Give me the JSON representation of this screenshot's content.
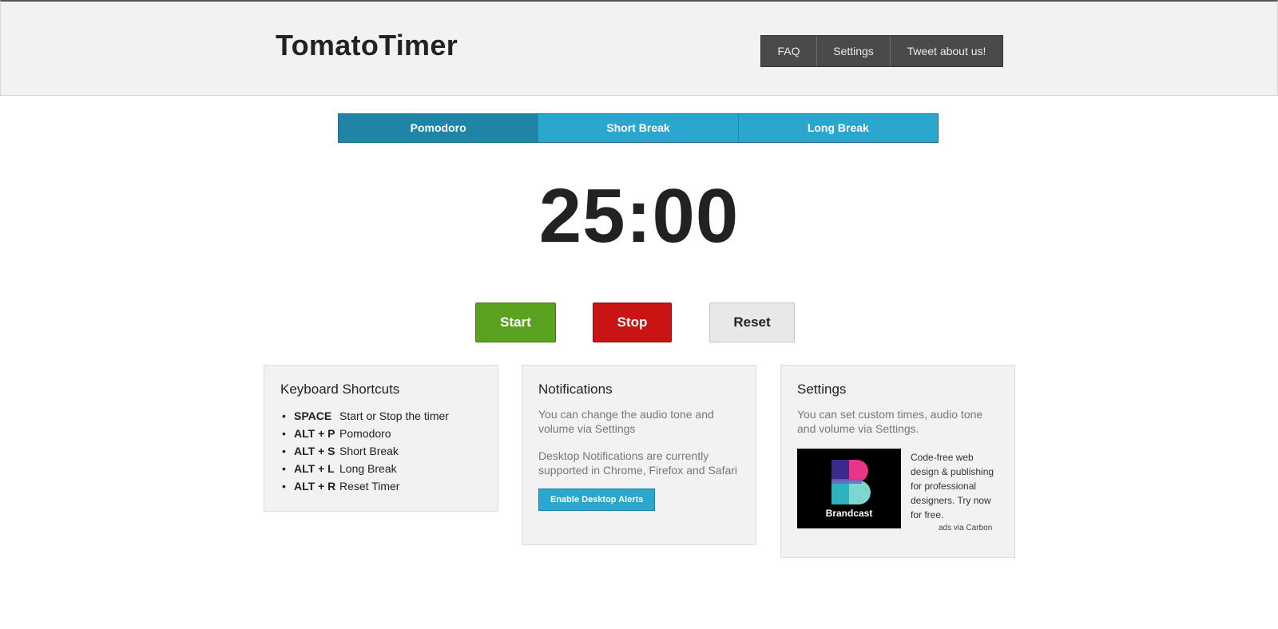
{
  "header": {
    "logo": "TomatoTimer",
    "nav": [
      "FAQ",
      "Settings",
      "Tweet about us!"
    ]
  },
  "tabs": {
    "items": [
      "Pomodoro",
      "Short Break",
      "Long Break"
    ],
    "active": "Pomodoro"
  },
  "timer": {
    "display": "25:00"
  },
  "controls": {
    "start": "Start",
    "stop": "Stop",
    "reset": "Reset"
  },
  "shortcuts_panel": {
    "title": "Keyboard Shortcuts",
    "items": [
      {
        "key": "SPACE",
        "action": "Start or Stop the timer"
      },
      {
        "key": "ALT + P",
        "action": "Pomodoro"
      },
      {
        "key": "ALT + S",
        "action": "Short Break"
      },
      {
        "key": "ALT + L",
        "action": "Long Break"
      },
      {
        "key": "ALT + R",
        "action": "Reset Timer"
      }
    ]
  },
  "notifications_panel": {
    "title": "Notifications",
    "text1": "You can change the audio tone and volume via Settings",
    "text2": "Desktop Notifications are currently supported in Chrome, Firefox and Safari",
    "button": "Enable Desktop Alerts"
  },
  "settings_panel": {
    "title": "Settings",
    "text": "You can set custom times, audio tone and volume via Settings.",
    "ad": {
      "brand": "Brandcast",
      "text": "Code-free web design & publishing for professional designers. Try now for free.",
      "via": "ads via Carbon"
    }
  },
  "colors": {
    "tab_bg": "#2aa6cf",
    "tab_active": "#1f84a6",
    "start": "#5aa21f",
    "stop": "#c91414",
    "reset": "#e8e8e8"
  }
}
